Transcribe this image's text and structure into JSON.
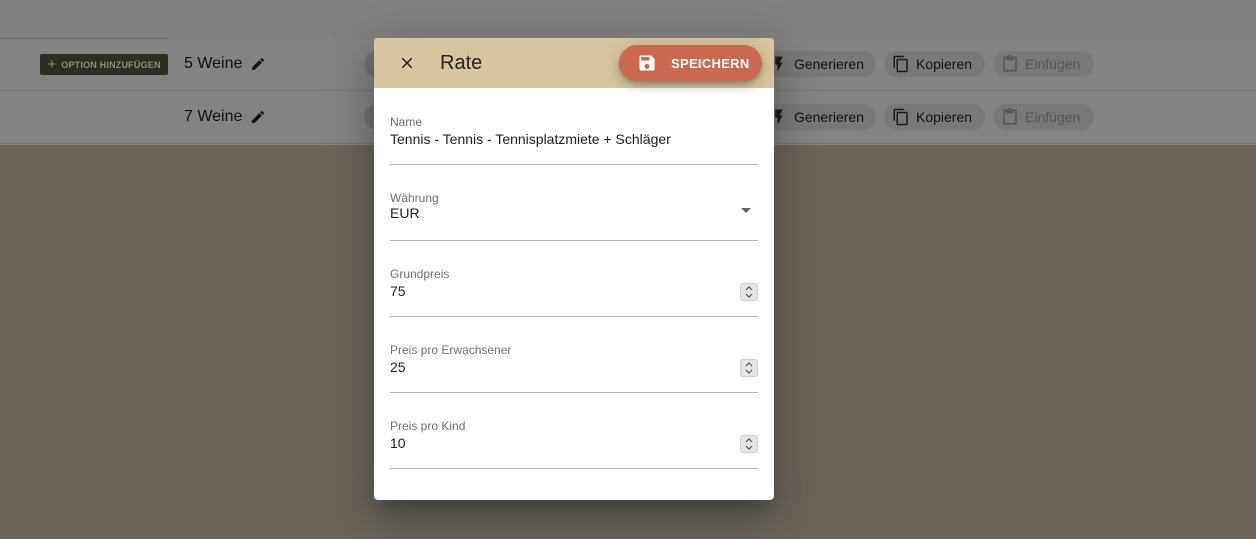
{
  "background": {
    "add_option_label": "OPTION HINZUFÜGEN",
    "rows": [
      {
        "title": "5 Weine",
        "generate_label": "Generieren",
        "copy_label": "Kopieren",
        "paste_label": "Einfügen"
      },
      {
        "title": "7 Weine",
        "generate_label": "Generieren",
        "copy_label": "Kopieren",
        "paste_label": "Einfügen"
      }
    ]
  },
  "dialog": {
    "title": "Rate",
    "save_label": "SPEICHERN",
    "fields": {
      "name": {
        "label": "Name",
        "value": "Tennis - Tennis - Tennisplatzmiete + Schläger"
      },
      "currency": {
        "label": "Währung",
        "value": "EUR"
      },
      "base_price": {
        "label": "Grundpreis",
        "value": "75"
      },
      "adult_price": {
        "label": "Preis pro Erwachsener",
        "value": "25"
      },
      "child_price": {
        "label": "Preis pro Kind",
        "value": "10"
      }
    }
  },
  "colors": {
    "toolbar": "#d7c59e",
    "save_button": "#c9694e",
    "add_option_button": "#4e5a3b",
    "backdrop": "#6b6259"
  },
  "icons": {
    "close": "close-icon",
    "save": "floppy-disk-icon",
    "edit": "pencil-icon",
    "generate": "lightning-bolt-icon",
    "copy": "copy-icon",
    "paste": "clipboard-icon",
    "add": "plus-icon",
    "dropdown": "caret-down-icon",
    "spinner": "up-down-spinner-icon"
  }
}
